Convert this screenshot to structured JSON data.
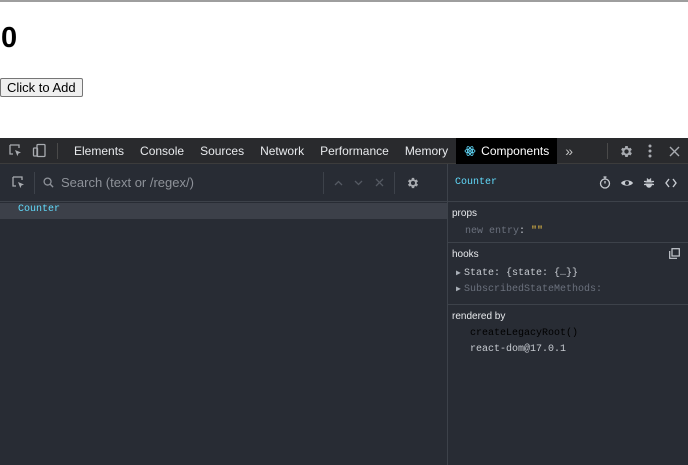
{
  "page": {
    "counter_value": "0",
    "add_button_label": "Click to Add"
  },
  "devtools": {
    "tabs": [
      {
        "label": "Elements"
      },
      {
        "label": "Console"
      },
      {
        "label": "Sources"
      },
      {
        "label": "Network"
      },
      {
        "label": "Performance"
      },
      {
        "label": "Memory"
      },
      {
        "label": "Components"
      }
    ],
    "active_tab": "Components",
    "more_tabs_glyph": "»"
  },
  "components": {
    "search_placeholder": "Search (text or /regex/)",
    "tree": [
      {
        "label": "Counter",
        "selected": true
      }
    ]
  },
  "inspector": {
    "selected_component": "Counter",
    "props": {
      "title": "props",
      "new_entry_key": "new entry",
      "new_entry_value": "\"\""
    },
    "hooks": {
      "title": "hooks",
      "items": [
        {
          "name": "State",
          "value": "{state: {…}}"
        },
        {
          "name": "SubscribedStateMethods",
          "value": ""
        }
      ]
    },
    "rendered_by": {
      "title": "rendered by",
      "items": [
        "createLegacyRoot()",
        "react-dom@17.0.1"
      ]
    }
  },
  "colors": {
    "accent": "#61dafb",
    "panel_bg": "#282c34",
    "value_yellow": "#f7c948"
  }
}
